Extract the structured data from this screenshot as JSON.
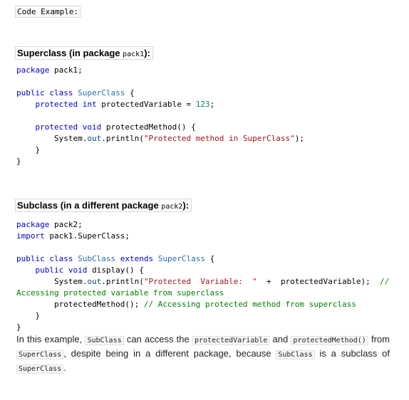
{
  "code_example_label": "Code Example:",
  "superclass_section": {
    "heading_text": "Superclass (in package ",
    "heading_code": "pack1",
    "heading_end": "):",
    "lines": [
      [
        {
          "t": "package",
          "c": "kw"
        },
        {
          "t": " pack1;"
        }
      ],
      [],
      [
        {
          "t": "public",
          "c": "kw"
        },
        {
          "t": " "
        },
        {
          "t": "class",
          "c": "kw"
        },
        {
          "t": " "
        },
        {
          "t": "SuperClass",
          "c": "ty"
        },
        {
          "t": " {"
        }
      ],
      [
        {
          "t": "    "
        },
        {
          "t": "protected",
          "c": "kw"
        },
        {
          "t": " "
        },
        {
          "t": "int",
          "c": "kw"
        },
        {
          "t": " protectedVariable = "
        },
        {
          "t": "123",
          "c": "num"
        },
        {
          "t": ";"
        }
      ],
      [],
      [
        {
          "t": "    "
        },
        {
          "t": "protected",
          "c": "kw"
        },
        {
          "t": " "
        },
        {
          "t": "void",
          "c": "kw"
        },
        {
          "t": " protectedMethod() {"
        }
      ],
      [
        {
          "t": "        System."
        },
        {
          "t": "out",
          "c": "fld"
        },
        {
          "t": ".println("
        },
        {
          "t": "\"Protected method in SuperClass\"",
          "c": "str"
        },
        {
          "t": ");"
        }
      ],
      [
        {
          "t": "    }"
        }
      ],
      [
        {
          "t": "}"
        }
      ]
    ]
  },
  "subclass_section": {
    "heading_text": "Subclass (in a different package ",
    "heading_code": "pack2",
    "heading_end": "):",
    "lines": [
      [
        {
          "t": "package",
          "c": "kw"
        },
        {
          "t": " pack2;"
        }
      ],
      [
        {
          "t": "import",
          "c": "kw"
        },
        {
          "t": " pack1.SuperClass;"
        }
      ],
      [],
      [
        {
          "t": "public",
          "c": "kw"
        },
        {
          "t": " "
        },
        {
          "t": "class",
          "c": "kw"
        },
        {
          "t": " "
        },
        {
          "t": "SubClass",
          "c": "ty"
        },
        {
          "t": " "
        },
        {
          "t": "extends",
          "c": "kw"
        },
        {
          "t": " "
        },
        {
          "t": "SuperClass",
          "c": "ty"
        },
        {
          "t": " {"
        }
      ],
      [
        {
          "t": "    "
        },
        {
          "t": "public",
          "c": "kw"
        },
        {
          "t": " "
        },
        {
          "t": "void",
          "c": "kw"
        },
        {
          "t": " display() {"
        }
      ],
      [
        {
          "t": "        System."
        },
        {
          "t": "out",
          "c": "fld"
        },
        {
          "t": ".println("
        },
        {
          "t": "\"Protected  Variable:  \"",
          "c": "str"
        },
        {
          "t": "  +  protectedVariable);  "
        },
        {
          "t": "//",
          "c": "cmt"
        }
      ],
      [
        {
          "t": "Accessing protected variable from superclass",
          "c": "cmt"
        }
      ],
      [
        {
          "t": "        protectedMethod(); "
        },
        {
          "t": "// Accessing protected method from superclass",
          "c": "cmt"
        }
      ],
      [
        {
          "t": "    }"
        }
      ],
      [
        {
          "t": "}"
        }
      ]
    ]
  },
  "explanation": [
    {
      "t": "In this example, "
    },
    {
      "t": "SubClass",
      "code": true
    },
    {
      "t": " can access the "
    },
    {
      "t": "protectedVariable",
      "code": true
    },
    {
      "t": " and "
    },
    {
      "t": "protectedMethod()",
      "code": true
    },
    {
      "t": " from "
    },
    {
      "t": "SuperClass",
      "code": true
    },
    {
      "t": ", despite being in a different package, because "
    },
    {
      "t": "SubClass",
      "code": true
    },
    {
      "t": " is a subclass of "
    },
    {
      "t": "SuperClass",
      "code": true
    },
    {
      "t": "."
    }
  ]
}
